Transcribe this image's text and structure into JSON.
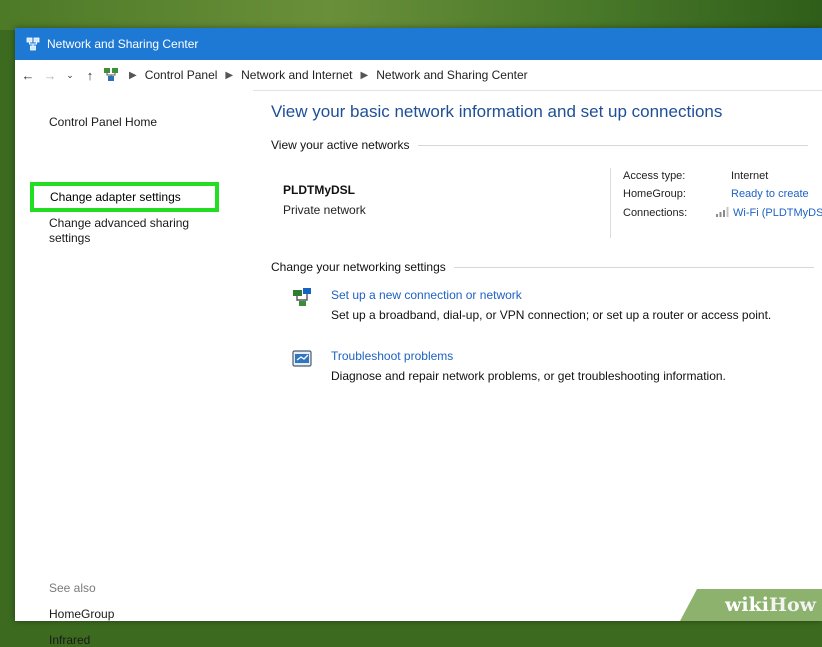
{
  "window": {
    "title": "Network and Sharing Center"
  },
  "address": {
    "crumbs": [
      "Control Panel",
      "Network and Internet",
      "Network and Sharing Center"
    ]
  },
  "sidebar": {
    "home": "Control Panel Home",
    "adapter": "Change adapter settings",
    "advanced_line1": "Change advanced sharing",
    "advanced_line2": "settings",
    "see_also": "See also",
    "homegroup": "HomeGroup",
    "infrared": "Infrared"
  },
  "main": {
    "title": "View your basic network information and set up connections",
    "active_label": "View your active networks",
    "network_name": "PLDTMyDSL",
    "network_type": "Private network",
    "access_type_label": "Access type:",
    "access_type_value": "Internet",
    "homegroup_label": "HomeGroup:",
    "homegroup_value": "Ready to create",
    "connections_label": "Connections:",
    "connections_value": "Wi-Fi (PLDTMyDSL)",
    "change_label": "Change your networking settings",
    "task1_link": "Set up a new connection or network",
    "task1_desc": "Set up a broadband, dial-up, or VPN connection; or set up a router or access point.",
    "task2_link": "Troubleshoot problems",
    "task2_desc": "Diagnose and repair network problems, or get troubleshooting information."
  },
  "watermark": {
    "wiki": "wiki",
    "how": "How"
  },
  "colors": {
    "titlebar": "#1e79d4",
    "link": "#1e62c4",
    "highlight": "#22dd22",
    "heading": "#1e4f96"
  }
}
